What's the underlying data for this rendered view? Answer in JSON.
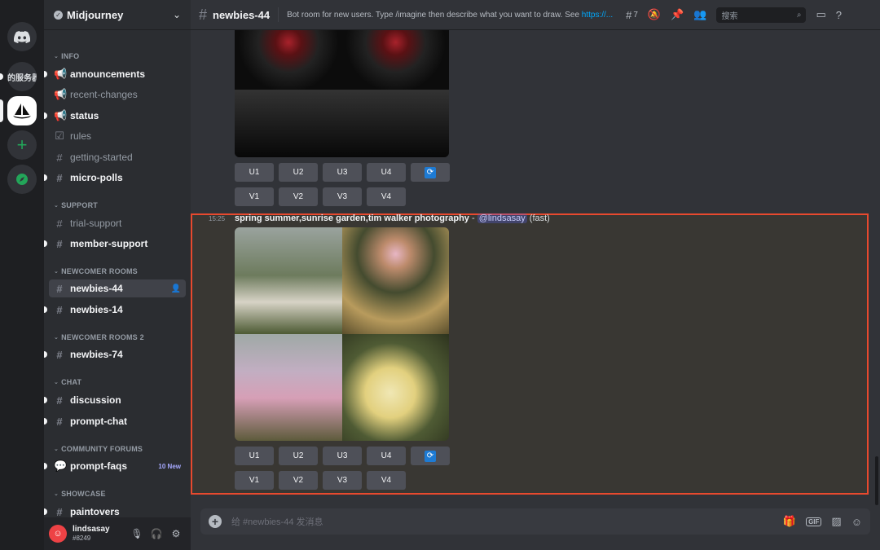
{
  "server": {
    "name": "Midjourney",
    "cn_server_label": "的服务器"
  },
  "sidebar": {
    "categories": {
      "info": "INFO",
      "support": "SUPPORT",
      "newcomer": "NEWCOMER ROOMS",
      "newcomer2": "NEWCOMER ROOMS 2",
      "chat": "CHAT",
      "forums": "COMMUNITY FORUMS",
      "showcase": "SHOWCASE"
    },
    "channels": {
      "announcements": "announcements",
      "recent_changes": "recent-changes",
      "status": "status",
      "rules": "rules",
      "getting_started": "getting-started",
      "micro_polls": "micro-polls",
      "trial_support": "trial-support",
      "member_support": "member-support",
      "newbies_44": "newbies-44",
      "newbies_14": "newbies-14",
      "newbies_74": "newbies-74",
      "discussion": "discussion",
      "prompt_chat": "prompt-chat",
      "prompt_faqs": "prompt-faqs",
      "paintovers": "paintovers"
    },
    "prompt_faqs_badge": "10 New"
  },
  "user": {
    "name": "lindsasay",
    "tag": "#8249"
  },
  "topbar": {
    "channel": "newbies-44",
    "topic": "Bot room for new users. Type /imagine then describe what you want to draw. See ",
    "topic_link": "https://...",
    "threads_count": "7",
    "search_placeholder": "搜索"
  },
  "messages": {
    "upscale_buttons": [
      "U1",
      "U2",
      "U3",
      "U4"
    ],
    "variation_buttons": [
      "V1",
      "V2",
      "V3",
      "V4"
    ],
    "highlighted": {
      "timestamp": "15:25",
      "prompt": "spring summer,sunrise garden,tim walker photography",
      "dash": " - ",
      "mention": "@lindsasay",
      "mode": " (fast)"
    }
  },
  "composer": {
    "placeholder": "给 #newbies-44 发消息"
  },
  "colors": {
    "accent": "#5865f2",
    "highlight_border": "#e8492e",
    "link": "#00a8fc"
  }
}
